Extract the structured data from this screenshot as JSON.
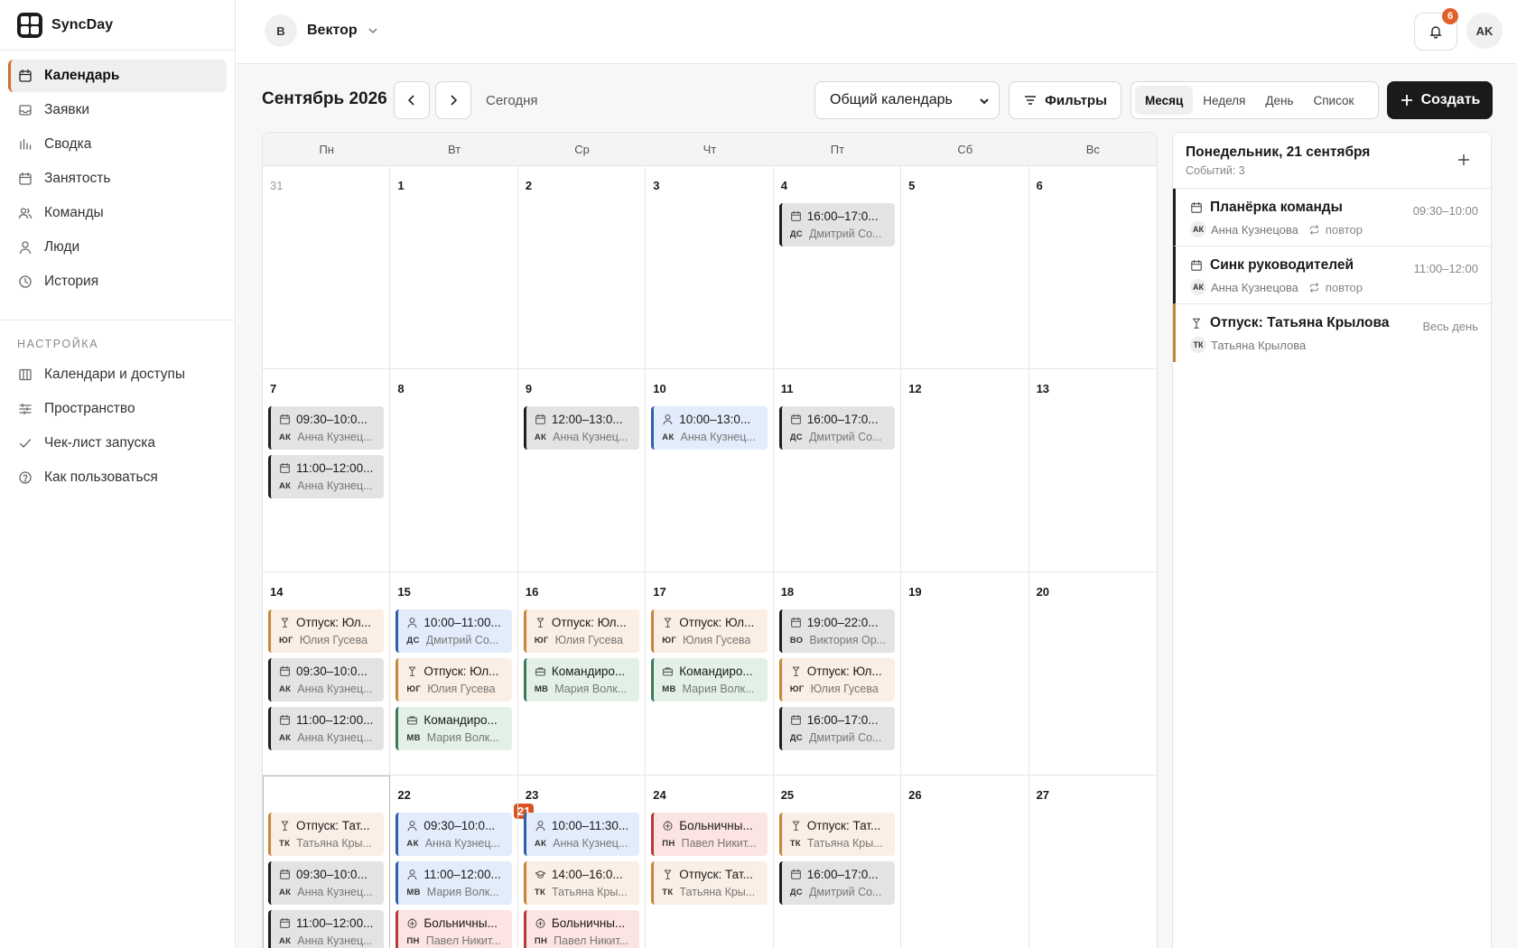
{
  "brand": "SyncDay",
  "nav": [
    {
      "label": "Календарь",
      "icon": "calendar-icon"
    },
    {
      "label": "Заявки",
      "icon": "inbox-icon"
    },
    {
      "label": "Сводка",
      "icon": "bar-chart-icon"
    },
    {
      "label": "Занятость",
      "icon": "calendar-icon"
    },
    {
      "label": "Команды",
      "icon": "users-icon"
    },
    {
      "label": "Люди",
      "icon": "user-icon"
    },
    {
      "label": "История",
      "icon": "clock-icon"
    }
  ],
  "settings_title": "НАСТРОЙКА",
  "settings": [
    {
      "label": "Календари и доступы",
      "icon": "columns-icon"
    },
    {
      "label": "Пространство",
      "icon": "sliders-icon"
    },
    {
      "label": "Чек-лист запуска",
      "icon": "check-icon"
    },
    {
      "label": "Как пользоваться",
      "icon": "help-icon"
    }
  ],
  "workspace": {
    "badge": "В",
    "name": "Вектор"
  },
  "notifications": "6",
  "user_initials": "AK",
  "calendar": {
    "title": "Сентябрь 2026",
    "today_label": "Сегодня",
    "select_value": "Общий календарь",
    "filters_label": "Фильтры",
    "views": [
      "Месяц",
      "Неделя",
      "День",
      "Список"
    ],
    "active_view": "Месяц",
    "create_label": "Создать",
    "weekdays": [
      "Пн",
      "Вт",
      "Ср",
      "Чт",
      "Пт",
      "Сб",
      "Вс"
    ]
  },
  "weeks": [
    [
      {
        "day": "31",
        "muted": true,
        "events": []
      },
      {
        "day": "1",
        "events": []
      },
      {
        "day": "2",
        "events": []
      },
      {
        "day": "3",
        "events": []
      },
      {
        "day": "4",
        "events": [
          {
            "title": "16:00–17:0...",
            "ini": "ДС",
            "who": "Дмитрий Со...",
            "color": "gray",
            "icon": "calendar-icon"
          }
        ]
      },
      {
        "day": "5",
        "events": []
      },
      {
        "day": "6",
        "events": []
      }
    ],
    [
      {
        "day": "7",
        "events": [
          {
            "title": "09:30–10:0...",
            "ini": "АК",
            "who": "Анна Кузнец...",
            "color": "gray",
            "icon": "calendar-icon"
          },
          {
            "title": "11:00–12:00...",
            "ini": "АК",
            "who": "Анна Кузнец...",
            "color": "gray",
            "icon": "calendar-icon"
          }
        ]
      },
      {
        "day": "8",
        "events": []
      },
      {
        "day": "9",
        "events": [
          {
            "title": "12:00–13:0...",
            "ini": "АК",
            "who": "Анна Кузнец...",
            "color": "gray",
            "icon": "calendar-icon"
          }
        ]
      },
      {
        "day": "10",
        "events": [
          {
            "title": "10:00–13:0...",
            "ini": "АК",
            "who": "Анна Кузнец...",
            "color": "blue",
            "icon": "person-icon"
          }
        ]
      },
      {
        "day": "11",
        "events": [
          {
            "title": "16:00–17:0...",
            "ini": "ДС",
            "who": "Дмитрий Со...",
            "color": "gray",
            "icon": "calendar-icon"
          }
        ]
      },
      {
        "day": "12",
        "events": []
      },
      {
        "day": "13",
        "events": []
      }
    ],
    [
      {
        "day": "14",
        "events": [
          {
            "title": "Отпуск: Юл...",
            "ini": "ЮГ",
            "who": "Юлия Гусева",
            "color": "orange",
            "icon": "vacation-icon"
          },
          {
            "title": "09:30–10:0...",
            "ini": "АК",
            "who": "Анна Кузнец...",
            "color": "gray",
            "icon": "calendar-icon"
          },
          {
            "title": "11:00–12:00...",
            "ini": "АК",
            "who": "Анна Кузнец...",
            "color": "gray",
            "icon": "calendar-icon"
          }
        ]
      },
      {
        "day": "15",
        "events": [
          {
            "title": "10:00–11:00...",
            "ini": "ДС",
            "who": "Дмитрий Со...",
            "color": "blue",
            "icon": "person-icon"
          },
          {
            "title": "Отпуск: Юл...",
            "ini": "ЮГ",
            "who": "Юлия Гусева",
            "color": "orange",
            "icon": "vacation-icon"
          },
          {
            "title": "Командиро...",
            "ini": "МВ",
            "who": "Мария Волк...",
            "color": "green",
            "icon": "briefcase-icon"
          }
        ]
      },
      {
        "day": "16",
        "events": [
          {
            "title": "Отпуск: Юл...",
            "ini": "ЮГ",
            "who": "Юлия Гусева",
            "color": "orange",
            "icon": "vacation-icon"
          },
          {
            "title": "Командиро...",
            "ini": "МВ",
            "who": "Мария Волк...",
            "color": "green",
            "icon": "briefcase-icon"
          }
        ]
      },
      {
        "day": "17",
        "events": [
          {
            "title": "Отпуск: Юл...",
            "ini": "ЮГ",
            "who": "Юлия Гусева",
            "color": "orange",
            "icon": "vacation-icon"
          },
          {
            "title": "Командиро...",
            "ini": "МВ",
            "who": "Мария Волк...",
            "color": "green",
            "icon": "briefcase-icon"
          }
        ]
      },
      {
        "day": "18",
        "events": [
          {
            "title": "19:00–22:0...",
            "ini": "ВО",
            "who": "Виктория Ор...",
            "color": "gray",
            "icon": "calendar-icon"
          },
          {
            "title": "Отпуск: Юл...",
            "ini": "ЮГ",
            "who": "Юлия Гусева",
            "color": "orange",
            "icon": "vacation-icon"
          },
          {
            "title": "16:00–17:0...",
            "ini": "ДС",
            "who": "Дмитрий Со...",
            "color": "gray",
            "icon": "calendar-icon"
          }
        ]
      },
      {
        "day": "19",
        "events": []
      },
      {
        "day": "20",
        "events": []
      }
    ],
    [
      {
        "day": "21",
        "today": true,
        "events": [
          {
            "title": "Отпуск: Тат...",
            "ini": "ТК",
            "who": "Татьяна Кры...",
            "color": "orange",
            "icon": "vacation-icon"
          },
          {
            "title": "09:30–10:0...",
            "ini": "АК",
            "who": "Анна Кузнец...",
            "color": "gray",
            "icon": "calendar-icon"
          },
          {
            "title": "11:00–12:00...",
            "ini": "АК",
            "who": "Анна Кузнец...",
            "color": "gray",
            "icon": "calendar-icon"
          }
        ]
      },
      {
        "day": "22",
        "events": [
          {
            "title": "09:30–10:0...",
            "ini": "АК",
            "who": "Анна Кузнец...",
            "color": "blue",
            "icon": "person-icon"
          },
          {
            "title": "11:00–12:00...",
            "ini": "МВ",
            "who": "Мария Волк...",
            "color": "blue",
            "icon": "person-icon"
          },
          {
            "title": "Больничны...",
            "ini": "ПН",
            "who": "Павел Никит...",
            "color": "red",
            "icon": "medical-icon"
          }
        ]
      },
      {
        "day": "23",
        "events": [
          {
            "title": "10:00–11:30...",
            "ini": "АК",
            "who": "Анна Кузнец...",
            "color": "blue",
            "icon": "person-icon"
          },
          {
            "title": "14:00–16:0...",
            "ini": "ТК",
            "who": "Татьяна Кры...",
            "color": "orange",
            "icon": "graduation-icon"
          },
          {
            "title": "Больничны...",
            "ini": "ПН",
            "who": "Павел Никит...",
            "color": "red",
            "icon": "medical-icon"
          }
        ]
      },
      {
        "day": "24",
        "events": [
          {
            "title": "Больничны...",
            "ini": "ПН",
            "who": "Павел Никит...",
            "color": "red",
            "icon": "medical-icon"
          },
          {
            "title": "Отпуск: Тат...",
            "ini": "ТК",
            "who": "Татьяна Кры...",
            "color": "orange",
            "icon": "vacation-icon"
          }
        ]
      },
      {
        "day": "25",
        "events": [
          {
            "title": "Отпуск: Тат...",
            "ini": "ТК",
            "who": "Татьяна Кры...",
            "color": "orange",
            "icon": "vacation-icon"
          },
          {
            "title": "16:00–17:0...",
            "ini": "ДС",
            "who": "Дмитрий Со...",
            "color": "gray",
            "icon": "calendar-icon"
          }
        ]
      },
      {
        "day": "26",
        "events": []
      },
      {
        "day": "27",
        "events": []
      }
    ]
  ],
  "panel": {
    "title": "Понедельник, 21 сентября",
    "subtitle": "Событий: 3",
    "events": [
      {
        "title": "Планёрка команды",
        "time": "09:30–10:00",
        "ini": "АК",
        "who": "Анна Кузнецова",
        "repeat": "повтор",
        "icon": "calendar-icon",
        "kind": "meeting"
      },
      {
        "title": "Синк руководителей",
        "time": "11:00–12:00",
        "ini": "АК",
        "who": "Анна Кузнецова",
        "repeat": "повтор",
        "icon": "calendar-icon",
        "kind": "meeting"
      },
      {
        "title": "Отпуск: Татьяна Крылова",
        "time": "Весь день",
        "ini": "ТК",
        "who": "Татьяна Крылова",
        "repeat": "",
        "icon": "vacation-icon",
        "kind": "vacation"
      }
    ]
  },
  "colors": {
    "accent": "#d9521f",
    "brand": "#1a1a1a"
  }
}
